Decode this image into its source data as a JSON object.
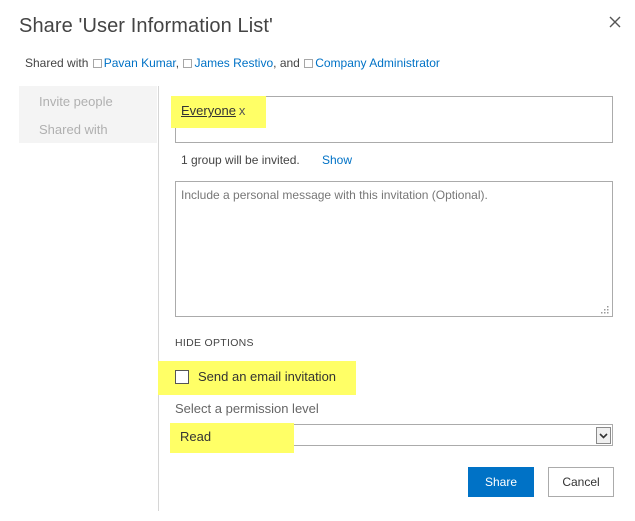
{
  "dialog": {
    "title": "Share 'User Information List'",
    "close_icon": "close-icon"
  },
  "shared_with": {
    "label": "Shared with",
    "people": [
      "Pavan Kumar",
      "James Restivo",
      "Company Administrator"
    ],
    "sep1": ",",
    "sep2": ", and"
  },
  "nav": {
    "items": [
      {
        "label": "Invite people"
      },
      {
        "label": "Shared with"
      }
    ]
  },
  "invite": {
    "token": "Everyone",
    "token_remove": "x",
    "count_text": "1 group will be invited.",
    "show_link": "Show"
  },
  "message": {
    "placeholder": "Include a personal message with this invitation (Optional)."
  },
  "options": {
    "hide_label": "HIDE OPTIONS",
    "send_email_label": "Send an email invitation",
    "send_email_checked": false,
    "permission_label": "Select a permission level",
    "permission_value": "Read"
  },
  "buttons": {
    "share": "Share",
    "cancel": "Cancel"
  },
  "colors": {
    "accent": "#0072c6",
    "highlight": "#ffff66"
  }
}
